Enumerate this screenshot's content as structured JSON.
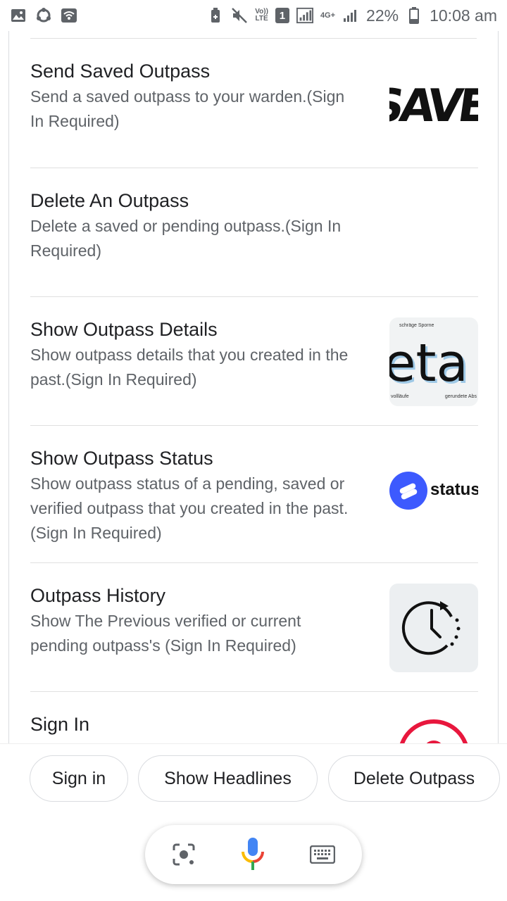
{
  "status_bar": {
    "volte_top": "Vo))",
    "volte_bottom": "LTE",
    "sim": "1",
    "network": "4G+",
    "battery": "22%",
    "time": "10:08 am",
    "icons": [
      "gallery-icon",
      "sync-icon",
      "wifi-icon",
      "battery-saver-icon",
      "mute-icon",
      "signal-icon",
      "battery-icon"
    ]
  },
  "items": [
    {
      "title": "Send Saved Outpass",
      "desc": "Send a saved outpass to your warden.(Sign In Required)",
      "thumb_text": "SAVE"
    },
    {
      "title": "Delete An Outpass",
      "desc": "Delete a saved or pending outpass.(Sign In Required)"
    },
    {
      "title": "Show Outpass Details",
      "desc": "Show outpass details that you created in the past.(Sign In Required)",
      "thumb_text": "eta",
      "thumb_caption_top": "schräge Sporne",
      "thumb_caption_left": "vollläufe",
      "thumb_caption_right": "gerundete Abs"
    },
    {
      "title": "Show Outpass Status",
      "desc": "Show outpass status of a pending, saved or verified outpass that you created in the past.(Sign In Required)",
      "thumb_text": "status"
    },
    {
      "title": "Outpass History",
      "desc": "Show The Previous verified or current pending outpass's (Sign In Required)"
    },
    {
      "title": "Sign In",
      "desc": ""
    }
  ],
  "chips": [
    "Sign in",
    "Show Headlines",
    "Delete Outpass"
  ],
  "assistant": {
    "icons": [
      "lens-icon",
      "mic-icon",
      "keyboard-icon"
    ],
    "colors": {
      "blue": "#4285F4",
      "red": "#EA4335",
      "yellow": "#FBBC04",
      "green": "#34A853"
    }
  }
}
